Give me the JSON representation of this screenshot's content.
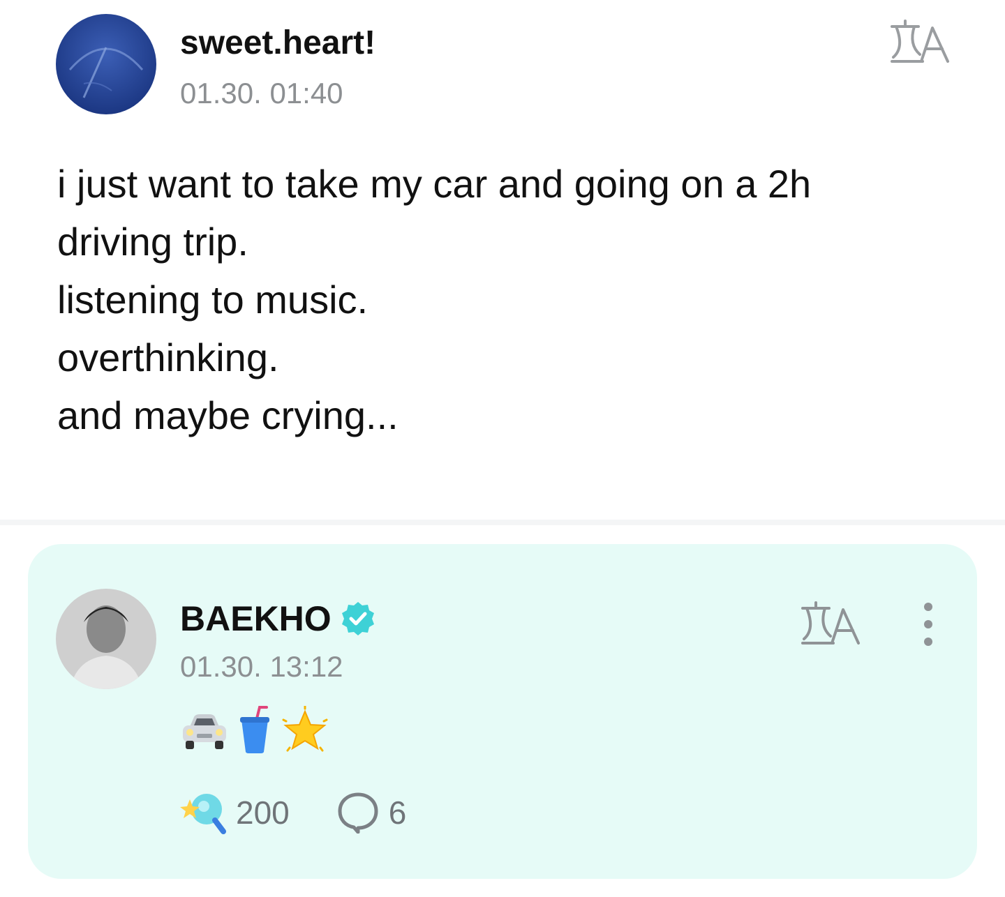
{
  "post": {
    "author": "sweet.heart!",
    "timestamp": "01.30. 01:40",
    "lines": [
      "i just want to take my car and going on a 2h",
      "driving trip.",
      "listening to music.",
      "overthinking.",
      "and maybe crying..."
    ],
    "translate_icon": "translate-icon"
  },
  "reply": {
    "author": "BAEKHO",
    "verified": true,
    "timestamp": "01.30. 13:12",
    "emojis": [
      "car-emoji",
      "cup-with-straw-emoji",
      "glowing-star-emoji"
    ],
    "likes": "200",
    "comments": "6",
    "translate_icon": "translate-icon",
    "more_icon": "more-vertical-icon"
  },
  "colors": {
    "card_background": "#e6fbf7",
    "timestamp_gray": "#8c8f92",
    "verified_badge": "#3ed1d6",
    "count_gray": "#6f7478"
  }
}
